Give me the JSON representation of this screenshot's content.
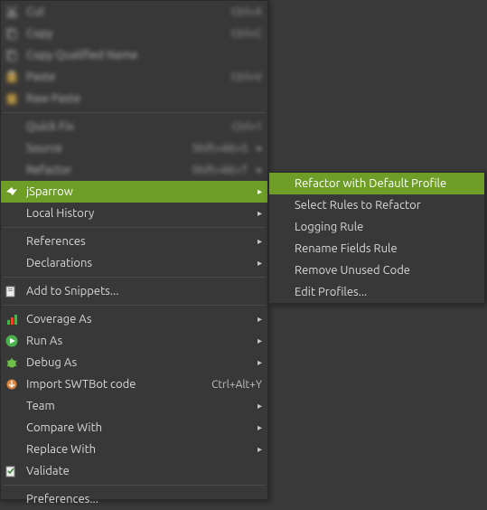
{
  "main_menu": {
    "blurred_top": [
      {
        "label": "Cut",
        "accel": "Ctrl+X",
        "icon": "cut-icon"
      },
      {
        "label": "Copy",
        "accel": "Ctrl+C",
        "icon": "copy-icon"
      },
      {
        "label": "Copy Qualified Name",
        "accel": "",
        "icon": "copy-qualified-icon"
      },
      {
        "label": "Paste",
        "accel": "Ctrl+V",
        "icon": "paste-icon"
      },
      {
        "label": "Raw Paste",
        "accel": "",
        "icon": "raw-paste-icon"
      }
    ],
    "blurred_mid": [
      {
        "label": "Quick Fix",
        "accel": "Ctrl+1",
        "submenu": false
      },
      {
        "label": "Source",
        "accel": "Shift+Alt+S",
        "submenu": true
      },
      {
        "label": "Refactor",
        "accel": "Shift+Alt+T",
        "submenu": true
      }
    ],
    "jsparrow": {
      "label": "jSparrow",
      "icon": "jsparrow-icon"
    },
    "local_history": {
      "label": "Local History"
    },
    "references": {
      "label": "References"
    },
    "declarations": {
      "label": "Declarations"
    },
    "add_snippets": {
      "label": "Add to Snippets...",
      "icon": "snippets-icon"
    },
    "coverage": {
      "label": "Coverage As",
      "icon": "coverage-icon"
    },
    "run": {
      "label": "Run As",
      "icon": "run-icon"
    },
    "debug": {
      "label": "Debug As",
      "icon": "debug-icon"
    },
    "import_swtbot": {
      "label": "Import SWTBot code",
      "accel": "Ctrl+Alt+Y",
      "icon": "import-icon"
    },
    "team": {
      "label": "Team"
    },
    "compare": {
      "label": "Compare With"
    },
    "replace": {
      "label": "Replace With"
    },
    "validate": {
      "label": "Validate",
      "icon": "validate-icon"
    },
    "preferences": {
      "label": "Preferences..."
    }
  },
  "sub_menu": {
    "items": [
      {
        "label": "Refactor with Default Profile",
        "highlight": true
      },
      {
        "label": "Select Rules to Refactor"
      },
      {
        "label": "Logging Rule"
      },
      {
        "label": "Rename Fields Rule"
      },
      {
        "label": "Remove Unused Code"
      },
      {
        "label": "Edit Profiles..."
      }
    ]
  },
  "glyphs": {
    "arrow": "▸"
  }
}
